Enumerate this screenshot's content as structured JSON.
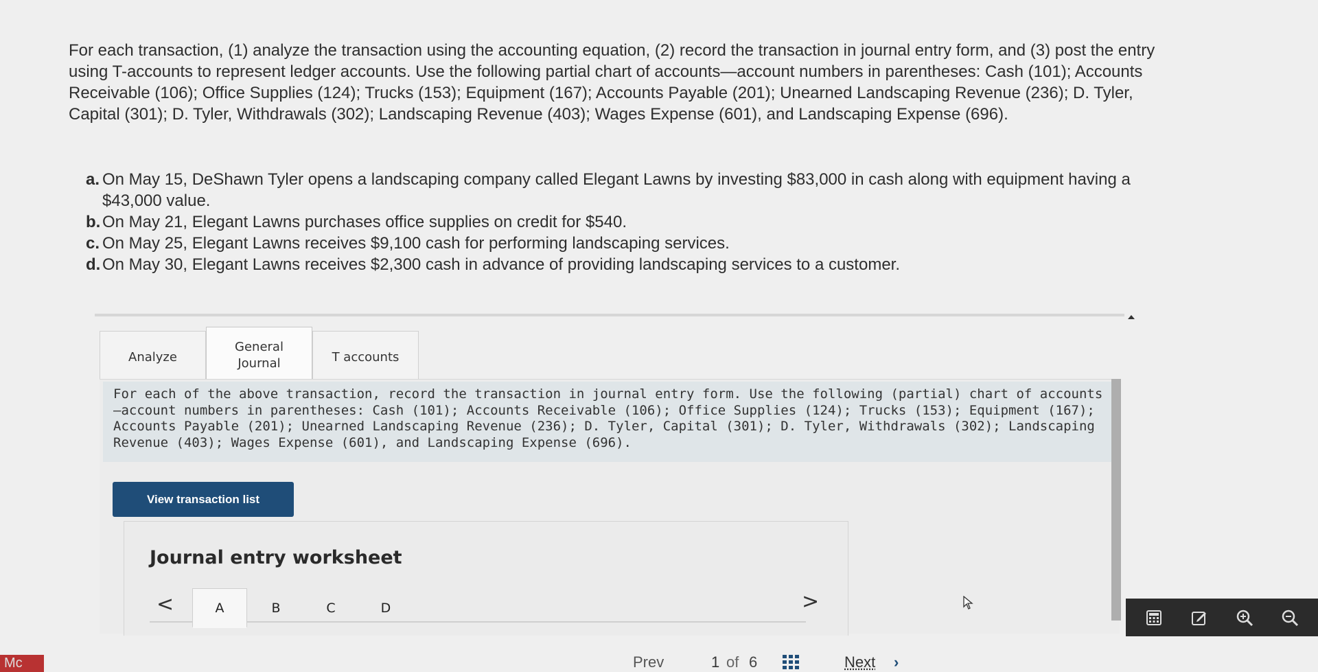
{
  "intro": {
    "text": "For each transaction, (1) analyze the transaction using the accounting equation, (2) record the transaction in journal entry form, and (3) post the entry using T-accounts to represent ledger accounts. Use the following partial chart of accounts—account numbers in parentheses: Cash (101); Accounts Receivable (106); Office Supplies (124); Trucks (153); Equipment (167); Accounts Payable (201); Unearned Landscaping Revenue (236); D. Tyler, Capital (301); D. Tyler, Withdrawals (302); Landscaping Revenue (403); Wages Expense (601), and Landscaping Expense (696)."
  },
  "transactions": [
    {
      "letter": "a.",
      "text": "On May 15, DeShawn Tyler opens a landscaping company called Elegant Lawns by investing $83,000 in cash along with equipment having a $43,000 value."
    },
    {
      "letter": "b.",
      "text": "On May 21, Elegant Lawns purchases office supplies on credit for $540."
    },
    {
      "letter": "c.",
      "text": "On May 25, Elegant Lawns receives $9,100 cash for performing landscaping services."
    },
    {
      "letter": "d.",
      "text": "On May 30, Elegant Lawns receives $2,300 cash in advance of providing landscaping services to a customer."
    }
  ],
  "tabs": {
    "analyze": "Analyze",
    "general_journal": "General\nJournal",
    "t_accounts": "T accounts"
  },
  "instructions": "For each of the above transaction, record the transaction in journal entry form. Use the following (partial) chart of accounts—account numbers in parentheses: Cash (101); Accounts Receivable (106); Office Supplies (124); Trucks (153); Equipment (167); Accounts Payable (201); Unearned Landscaping Revenue (236); D. Tyler, Capital (301); D. Tyler, Withdrawals (302); Landscaping Revenue (403); Wages Expense (601), and Landscaping Expense (696).",
  "view_button": "View transaction list",
  "worksheet": {
    "title": "Journal entry worksheet",
    "prev": "<",
    "next": ">",
    "tabs": [
      "A",
      "B",
      "C",
      "D"
    ],
    "active_tab": "A"
  },
  "footer": {
    "badge": "Mc",
    "prev": "Prev",
    "page_current": "1",
    "page_of": "of",
    "page_total": "6",
    "next": "Next"
  },
  "toolbar_icons": [
    "calculator-icon",
    "edit-icon",
    "zoom-in-icon",
    "zoom-out-icon"
  ],
  "colors": {
    "button_bg": "#1f4d78",
    "instructions_bg": "#dfe5e8",
    "badge_bg": "#b83232",
    "toolbar_bg": "#2b2b2b"
  }
}
